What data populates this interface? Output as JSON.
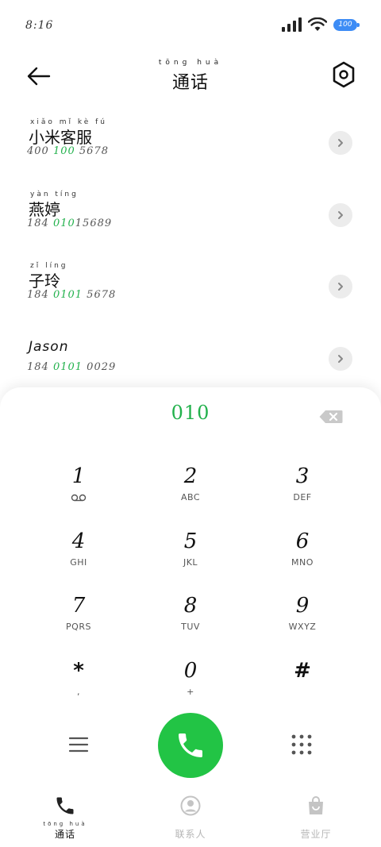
{
  "status_bar": {
    "time": "8:16",
    "battery": "100"
  },
  "header": {
    "title_pinyin": "tōng huà",
    "title": "通话"
  },
  "recents": [
    {
      "pinyin": "xiǎo mǐ kè fú",
      "name": "小米客服",
      "number_pre": "400 ",
      "number_hl": "100",
      "number_post": " 5678"
    },
    {
      "pinyin": "yàn tíng",
      "name": "燕婷",
      "number_pre": "184 ",
      "number_hl": "010",
      "number_post": "15689"
    },
    {
      "pinyin": "zǐ líng",
      "name": "子玲",
      "number_pre": "184 ",
      "number_hl": "0101",
      "number_post": " 5678"
    },
    {
      "pinyin": "",
      "name": "Jason",
      "number_pre": "184 ",
      "number_hl": "0101",
      "number_post": " 0029"
    }
  ],
  "dialpad": {
    "dialed": "010",
    "keys": [
      {
        "digit": "1",
        "letters": ""
      },
      {
        "digit": "2",
        "letters": "ABC"
      },
      {
        "digit": "3",
        "letters": "DEF"
      },
      {
        "digit": "4",
        "letters": "GHI"
      },
      {
        "digit": "5",
        "letters": "JKL"
      },
      {
        "digit": "6",
        "letters": "MNO"
      },
      {
        "digit": "7",
        "letters": "PQRS"
      },
      {
        "digit": "8",
        "letters": "TUV"
      },
      {
        "digit": "9",
        "letters": "WXYZ"
      },
      {
        "digit": "*",
        "letters": ","
      },
      {
        "digit": "0",
        "letters": "+"
      },
      {
        "digit": "#",
        "letters": ""
      }
    ]
  },
  "bottom_nav": [
    {
      "pinyin": "tōng huà",
      "label": "通话",
      "active": true
    },
    {
      "pinyin": "",
      "label": "联系人",
      "active": false
    },
    {
      "pinyin": "",
      "label": "营业厅",
      "active": false
    }
  ],
  "colors": {
    "accent_green": "#22c445",
    "battery_blue": "#3d8cf5"
  }
}
